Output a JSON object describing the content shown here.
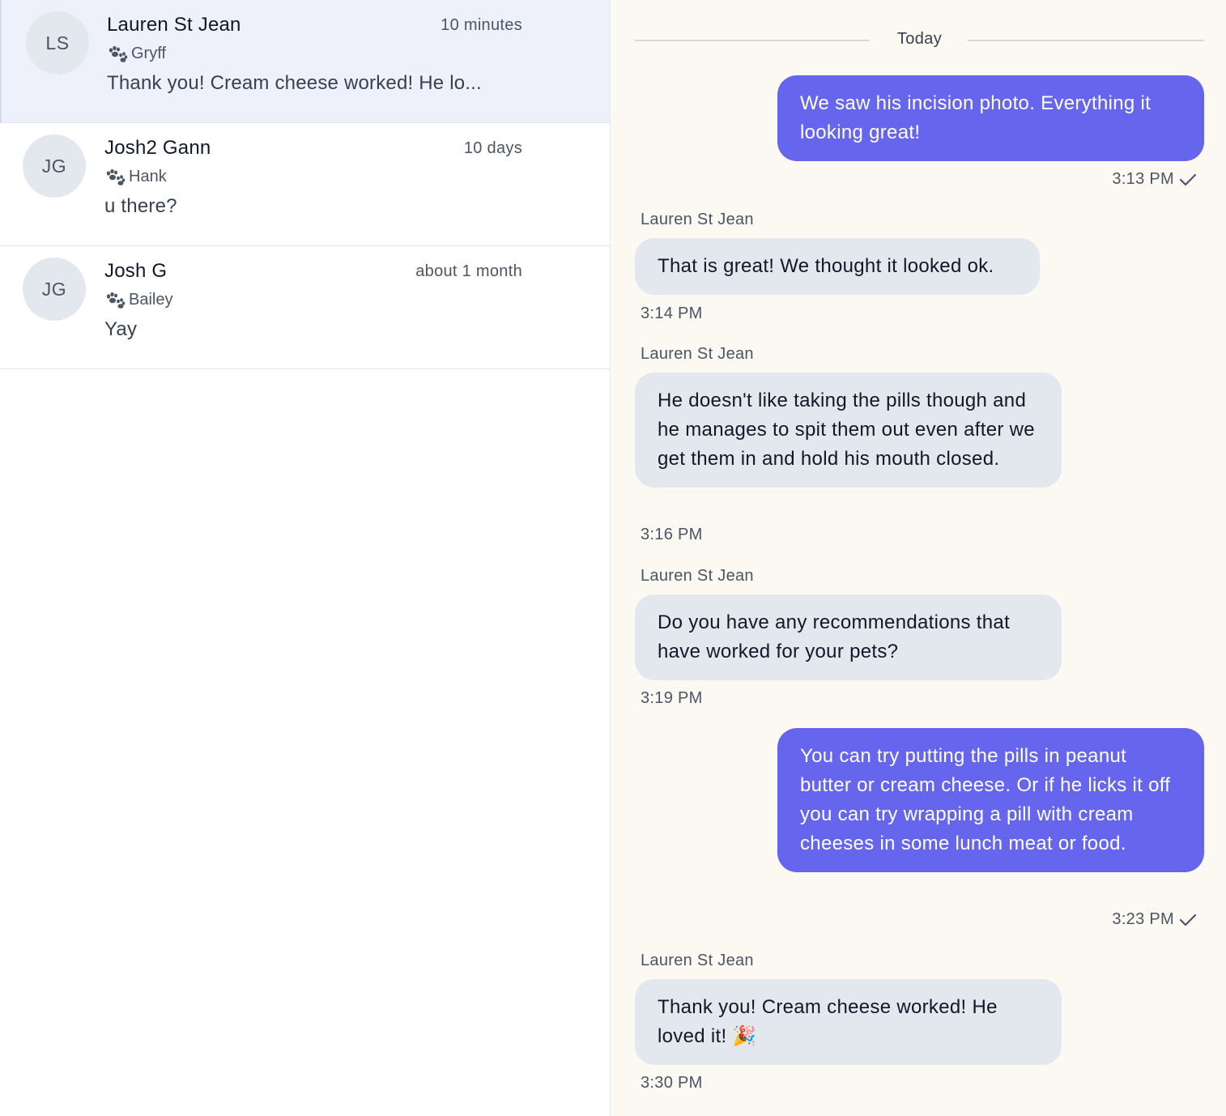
{
  "conversations": [
    {
      "initials": "LS",
      "name": "Lauren St Jean",
      "time": "10 minutes",
      "pet": "Gryff",
      "preview": "Thank you! Cream cheese worked! He lo...",
      "active": true
    },
    {
      "initials": "JG",
      "name": "Josh2 Gann",
      "time": "10 days",
      "pet": "Hank",
      "preview": "u there?",
      "active": false
    },
    {
      "initials": "JG",
      "name": "Josh G",
      "time": "about 1 month",
      "pet": "Bailey",
      "preview": "Yay",
      "active": false
    }
  ],
  "thread": {
    "day_label": "Today",
    "messages": [
      {
        "direction": "out",
        "text": "We saw his incision photo. Everything it looking great!",
        "time": "3:13 PM",
        "read": true
      },
      {
        "direction": "in",
        "sender": "Lauren St Jean",
        "text": "That is great! We thought it looked ok.",
        "time": "3:14 PM"
      },
      {
        "direction": "in",
        "sender": "Lauren St Jean",
        "text": "He doesn't like taking the pills though and he manages to spit them out even after we get them in and hold his mouth closed.",
        "time": "3:16 PM"
      },
      {
        "direction": "in",
        "sender": "Lauren St Jean",
        "text": "Do you have any recommendations that have worked for your pets?",
        "time": "3:19 PM"
      },
      {
        "direction": "out",
        "text": "You can try putting the pills in peanut butter or cream cheese. Or if he licks it off you can try wrapping a pill with cream cheeses in some lunch meat or food.",
        "time": "3:23 PM",
        "read": true
      },
      {
        "direction": "in",
        "sender": "Lauren St Jean",
        "text": "Thank you! Cream cheese worked! He loved it! 🎉",
        "time": "3:30 PM"
      }
    ]
  },
  "colors": {
    "accent": "#6665ee",
    "incoming_bubble": "#e3e8ef",
    "thread_bg": "#fbf9f2",
    "active_row": "#eef0fb"
  },
  "icons": {
    "pet": "paw-icon",
    "read": "check-icon"
  }
}
